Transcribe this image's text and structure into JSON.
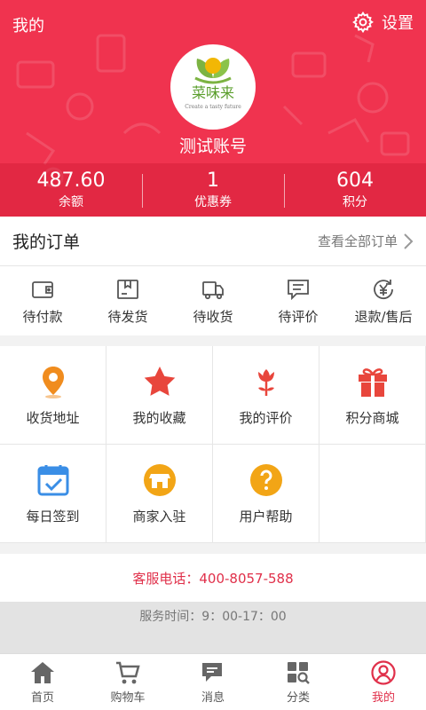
{
  "header": {
    "title": "我的",
    "settings_label": "设置",
    "account_name": "测试账号",
    "logo_text": "菜味来",
    "logo_tagline": "Create a tasty future",
    "bg_color": "#f0334f"
  },
  "stats": [
    {
      "value": "487.60",
      "label": "余额"
    },
    {
      "value": "1",
      "label": "优惠券"
    },
    {
      "value": "604",
      "label": "积分"
    }
  ],
  "orders": {
    "title": "我的订单",
    "view_all": "查看全部订单",
    "items": [
      {
        "label": "待付款",
        "icon": "wallet-icon"
      },
      {
        "label": "待发货",
        "icon": "box-icon"
      },
      {
        "label": "待收货",
        "icon": "truck-icon"
      },
      {
        "label": "待评价",
        "icon": "comment-icon"
      },
      {
        "label": "退款/售后",
        "icon": "refund-icon"
      }
    ]
  },
  "grid": [
    {
      "label": "收货地址",
      "icon": "location-pin-icon",
      "color": "#f08c1e"
    },
    {
      "label": "我的收藏",
      "icon": "star-icon",
      "color": "#e8463c"
    },
    {
      "label": "我的评价",
      "icon": "tulip-icon",
      "color": "#e8463c"
    },
    {
      "label": "积分商城",
      "icon": "gift-icon",
      "color": "#e8463c"
    },
    {
      "label": "每日签到",
      "icon": "calendar-check-icon",
      "color": "#3a8ee6"
    },
    {
      "label": "商家入驻",
      "icon": "store-icon",
      "color": "#f2a516"
    },
    {
      "label": "用户帮助",
      "icon": "help-icon",
      "color": "#f2a516"
    }
  ],
  "service": {
    "phone_text": "客服电话：400-8057-588",
    "hours_text": "服务时间：9：00-17：00",
    "accent_color": "#e0304a"
  },
  "nav": [
    {
      "label": "首页",
      "icon": "home-icon",
      "active": false
    },
    {
      "label": "购物车",
      "icon": "cart-icon",
      "active": false
    },
    {
      "label": "消息",
      "icon": "message-icon",
      "active": false
    },
    {
      "label": "分类",
      "icon": "category-icon",
      "active": false
    },
    {
      "label": "我的",
      "icon": "profile-icon",
      "active": true
    }
  ]
}
